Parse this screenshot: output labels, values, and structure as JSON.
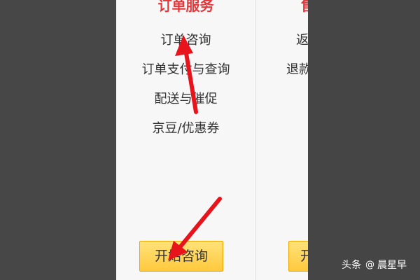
{
  "panel1": {
    "title": "订单服务",
    "links": [
      "订单咨询",
      "订单支付与查询",
      "配送与催促",
      "京豆/优惠券"
    ],
    "button_label": "开始咨询"
  },
  "panel2": {
    "title": "售",
    "links": [
      "返",
      "退款"
    ],
    "button_label": "开"
  },
  "watermark": {
    "source": "头条",
    "author": "晨星早"
  },
  "colors": {
    "title_red": "#e4393c",
    "arrow_red": "#e8141c",
    "button_yellow": "#ffc93d"
  }
}
